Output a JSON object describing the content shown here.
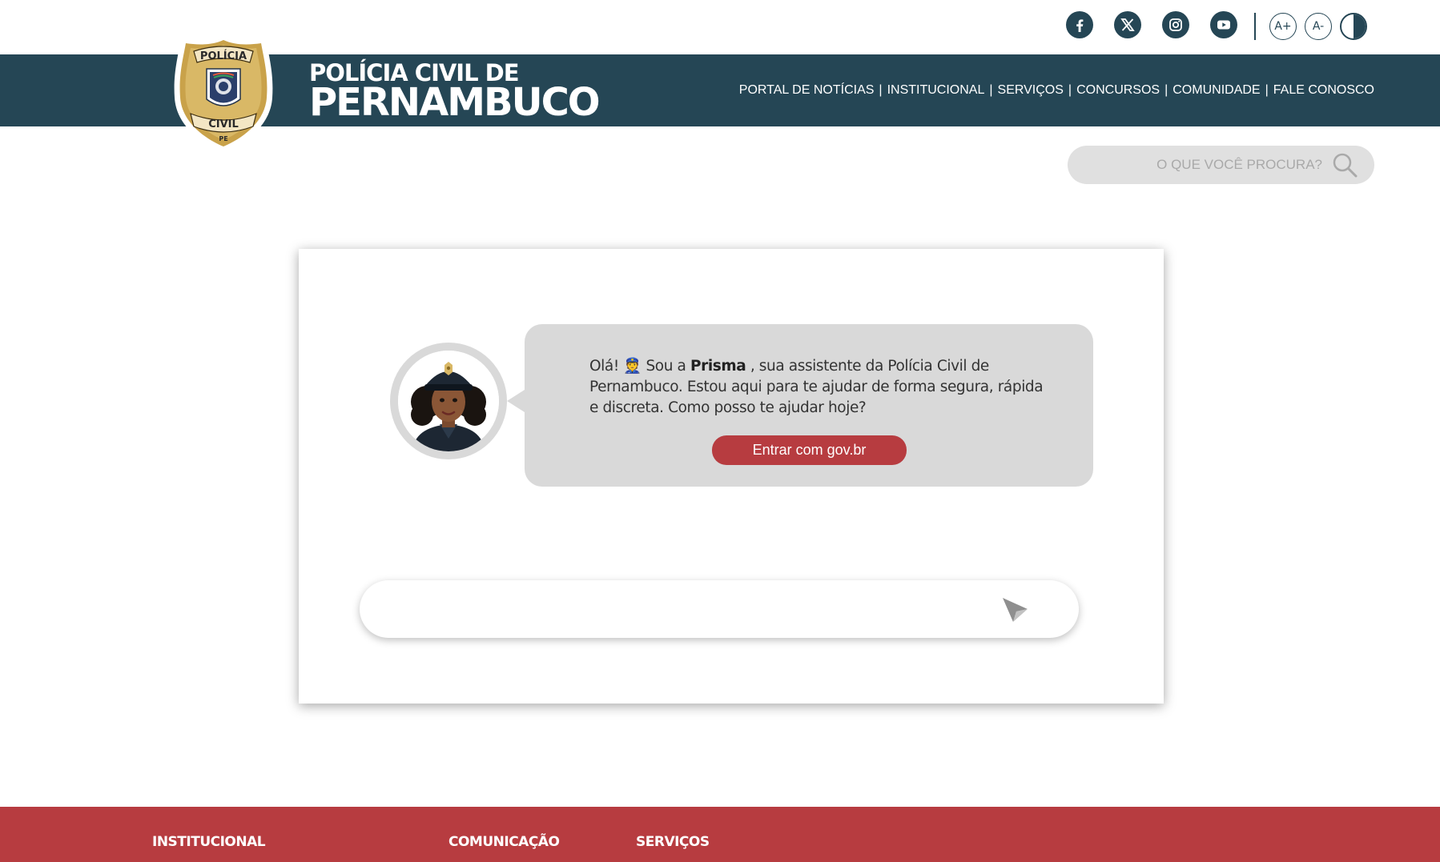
{
  "social": {
    "facebook": "facebook-icon",
    "x": "x-twitter-icon",
    "instagram": "instagram-icon",
    "youtube": "youtube-icon"
  },
  "accessibility": {
    "increase_font": "A+",
    "decrease_font": "A-",
    "contrast": "contrast-icon"
  },
  "brand": {
    "line1": "POLÍCIA CIVIL DE",
    "line2": "PERNAMBUCO",
    "badge_text_top": "POLÍCIA",
    "badge_text_bottom": "CIVIL",
    "badge_text_state": "PE"
  },
  "nav": {
    "items": [
      "PORTAL DE NOTÍCIAS",
      "INSTITUCIONAL",
      "SERVIÇOS",
      "CONCURSOS",
      "COMUNIDADE",
      "FALE CONOSCO"
    ],
    "separator": "|"
  },
  "search": {
    "placeholder": "O QUE VOCÊ PROCURA?"
  },
  "chat": {
    "greeting_start": "Olá! 👮 Sou a ",
    "assistant_name": "Prisma",
    "greeting_end": " , sua assistente da Polícia Civil de Pernambuco.  Estou aqui para te ajudar de forma segura, rápida e discreta. Como posso te ajudar hoje?",
    "login_button": "Entrar com gov.br",
    "input_value": ""
  },
  "footer": {
    "columns": [
      "INSTITUCIONAL",
      "COMUNICAÇÃO",
      "SERVIÇOS"
    ]
  },
  "colors": {
    "header": "#254655",
    "accent_red": "#b73c40",
    "bubble": "#d9d9d9"
  }
}
